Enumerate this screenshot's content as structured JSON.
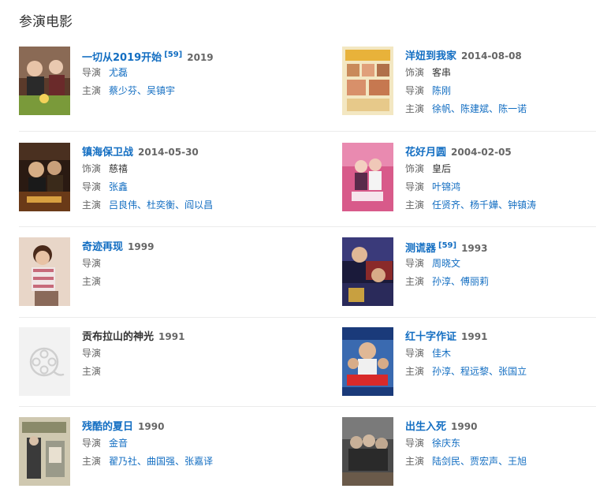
{
  "section": {
    "title": "参演电影"
  },
  "movies": [
    {
      "title": "一切从2019开始",
      "ref": "[59]",
      "date": "2019",
      "lines": [
        {
          "label": "导演",
          "values": [
            "尤磊"
          ]
        },
        {
          "label": "主演",
          "values": [
            "蔡少芬",
            "吴镇宇"
          ]
        }
      ]
    },
    {
      "title": "洋妞到我家",
      "date": "2014-08-08",
      "lines": [
        {
          "label": "饰演",
          "values": [
            "客串"
          ]
        },
        {
          "label": "导演",
          "values": [
            "陈刚"
          ]
        },
        {
          "label": "主演",
          "values": [
            "徐帆",
            "陈建斌",
            "陈一诺"
          ]
        }
      ]
    },
    {
      "title": "镇海保卫战",
      "date": "2014-05-30",
      "lines": [
        {
          "label": "饰演",
          "values": [
            "慈禧"
          ]
        },
        {
          "label": "导演",
          "values": [
            "张鑫"
          ]
        },
        {
          "label": "主演",
          "values": [
            "吕良伟",
            "杜奕衡",
            "阎以昌"
          ]
        }
      ]
    },
    {
      "title": "花好月圆",
      "date": "2004-02-05",
      "lines": [
        {
          "label": "饰演",
          "values": [
            "皇后"
          ]
        },
        {
          "label": "导演",
          "values": [
            "叶锦鸿"
          ]
        },
        {
          "label": "主演",
          "values": [
            "任贤齐",
            "杨千嬅",
            "钟镇涛"
          ]
        }
      ]
    },
    {
      "title": "奇迹再现",
      "date": "1999",
      "lines": [
        {
          "label": "导演",
          "values": []
        },
        {
          "label": "主演",
          "values": []
        }
      ]
    },
    {
      "title": "测谎器",
      "ref": "[59]",
      "date": "1993",
      "lines": [
        {
          "label": "导演",
          "values": [
            "周晓文"
          ]
        },
        {
          "label": "主演",
          "values": [
            "孙淳",
            "傅丽莉"
          ]
        }
      ]
    },
    {
      "title": "贡布拉山的神光",
      "date": "1991",
      "title_link": false,
      "lines": [
        {
          "label": "导演",
          "values": []
        },
        {
          "label": "主演",
          "values": []
        }
      ]
    },
    {
      "title": "红十字作证",
      "date": "1991",
      "lines": [
        {
          "label": "导演",
          "values": [
            "佳木"
          ]
        },
        {
          "label": "主演",
          "values": [
            "孙淳",
            "程远黎",
            "张国立"
          ]
        }
      ]
    },
    {
      "title": "残酷的夏日",
      "date": "1990",
      "lines": [
        {
          "label": "导演",
          "values": [
            "金音"
          ]
        },
        {
          "label": "主演",
          "values": [
            "翟乃社",
            "曲国强",
            "张嘉译"
          ]
        }
      ]
    },
    {
      "title": "出生入死",
      "date": "1990",
      "lines": [
        {
          "label": "导演",
          "values": [
            "徐庆东"
          ]
        },
        {
          "label": "主演",
          "values": [
            "陆剑民",
            "贾宏声",
            "王旭"
          ]
        }
      ]
    }
  ],
  "colors": {
    "link": "#136ec2",
    "label": "#666666",
    "divider": "#ebebeb"
  },
  "icons": {
    "placeholder_poster": "film-reel-icon"
  }
}
